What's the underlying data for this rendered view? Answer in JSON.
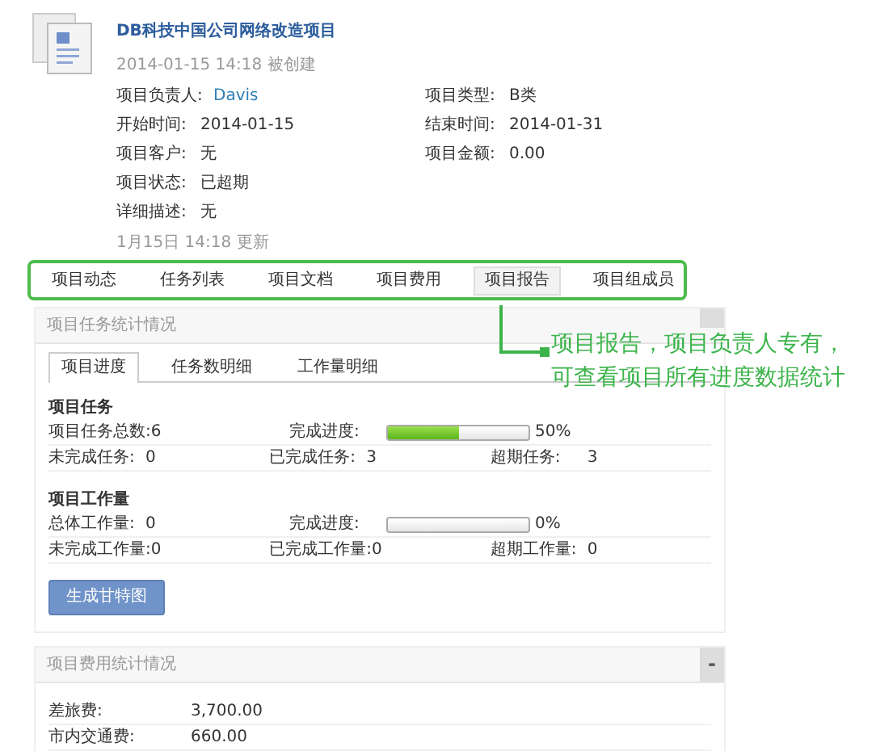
{
  "project": {
    "title": "DB科技中国公司网络改造项目",
    "created": "2014-01-15 14:18 被创建",
    "fields": [
      [
        {
          "label": "项目负责人:",
          "value": "Davis",
          "kind": "link"
        },
        {
          "label": "项目类型:",
          "value": "B类",
          "kind": "text"
        }
      ],
      [
        {
          "label": "开始时间:",
          "value": "2014-01-15",
          "kind": "text"
        },
        {
          "label": "结束时间:",
          "value": "2014-01-31",
          "kind": "text"
        }
      ],
      [
        {
          "label": "项目客户:",
          "value": "无",
          "kind": "text"
        },
        {
          "label": "项目金额:",
          "value": "0.00",
          "kind": "text"
        }
      ],
      [
        {
          "label": "项目状态:",
          "value": "已超期",
          "kind": "text"
        }
      ],
      [
        {
          "label": "详细描述:",
          "value": "无",
          "kind": "text"
        }
      ]
    ],
    "updated": "1月15日 14:18 更新"
  },
  "tabs": [
    {
      "label": "项目动态",
      "selected": false
    },
    {
      "label": "任务列表",
      "selected": false
    },
    {
      "label": "项目文档",
      "selected": false
    },
    {
      "label": "项目费用",
      "selected": false
    },
    {
      "label": "项目报告",
      "selected": true
    },
    {
      "label": "项目组成员",
      "selected": false
    }
  ],
  "callout": {
    "lines": [
      "项目报告，项目负责人专有，",
      "可查看项目所有进度数据统计"
    ]
  },
  "task_stats": {
    "title": "项目任务统计情况",
    "tabs": [
      {
        "label": "项目进度",
        "selected": true
      },
      {
        "label": "任务数明细",
        "selected": false
      },
      {
        "label": "工作量明细",
        "selected": false
      }
    ],
    "sections": [
      {
        "heading": "项目任务",
        "rows": [
          [
            {
              "kind": "pair",
              "label": "项目任务总数:",
              "value": "6"
            },
            {
              "kind": "progress",
              "label": "完成进度:",
              "level": 0.5,
              "reading": "50%"
            }
          ],
          [
            {
              "kind": "pair",
              "label": "未完成任务:",
              "value": "0"
            },
            {
              "kind": "pair",
              "label": "已完成任务:",
              "value": "3"
            },
            {
              "kind": "pair",
              "label": "超期任务:",
              "value": "3"
            }
          ]
        ]
      },
      {
        "heading": "项目工作量",
        "rows": [
          [
            {
              "kind": "pair",
              "label": "总体工作量:",
              "value": "0"
            },
            {
              "kind": "progress",
              "label": "完成进度:",
              "level": 0,
              "reading": "0%"
            }
          ],
          [
            {
              "kind": "pair",
              "label": "未完成工作量:",
              "value": "0"
            },
            {
              "kind": "pair",
              "label": "已完成工作量:",
              "value": "0"
            },
            {
              "kind": "pair",
              "label": "超期工作量:",
              "value": "0"
            }
          ]
        ]
      }
    ],
    "button": "生成甘特图"
  },
  "cost_stats": {
    "title": "项目费用统计情况",
    "toggle": "-",
    "rows": [
      {
        "label": "差旅费:",
        "value": "3,700.00"
      },
      {
        "label": "市内交通费:",
        "value": "660.00"
      }
    ]
  }
}
